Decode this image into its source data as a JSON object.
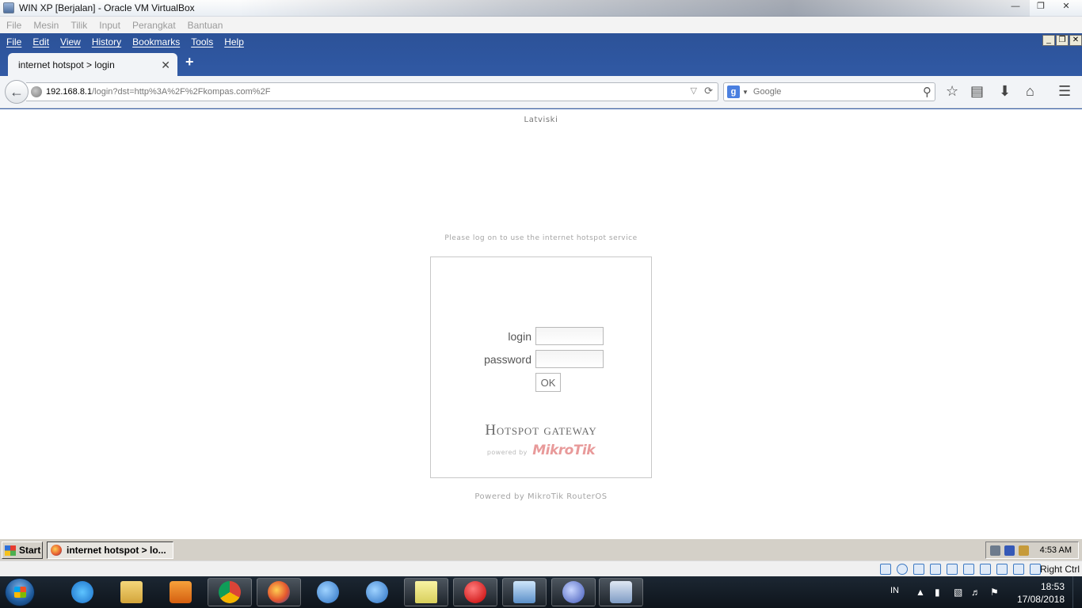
{
  "vbox": {
    "window_title": "WIN XP [Berjalan] - Oracle VM VirtualBox",
    "menu": [
      "File",
      "Mesin",
      "Tilik",
      "Input",
      "Perangkat",
      "Bantuan"
    ],
    "host_key": "Right Ctrl"
  },
  "firefox": {
    "menu": [
      "File",
      "Edit",
      "View",
      "History",
      "Bookmarks",
      "Tools",
      "Help"
    ],
    "tab_title": "internet hotspot > login",
    "url_host": "192.168.8.1",
    "url_path": "/login?dst=http%3A%2F%2Fkompas.com%2F",
    "search_placeholder": "Google"
  },
  "page": {
    "language_link": "Latviski",
    "notice": "Please log on to use the internet hotspot service",
    "login_label": "login",
    "password_label": "password",
    "login_value": "",
    "password_value": "",
    "ok_label": "OK",
    "gateway_title": "Hotspot gateway",
    "powered_by_small": "powered by",
    "mikrotik_logo": "MikroTik",
    "footer": "Powered by MikroTik RouterOS"
  },
  "xp_taskbar": {
    "start_label": "Start",
    "task_label": "internet hotspot > lo...",
    "clock": "4:53 AM"
  },
  "host_taskbar": {
    "language": "IN",
    "time": "18:53",
    "date": "17/08/2018"
  },
  "colors": {
    "firefox_chrome": "#2f57a1",
    "page_bg": "#ffffff",
    "mikrotik_logo": "#e89a9a",
    "xp_taskbar": "#d4d0c8",
    "w7_taskbar": "#1c2733"
  }
}
